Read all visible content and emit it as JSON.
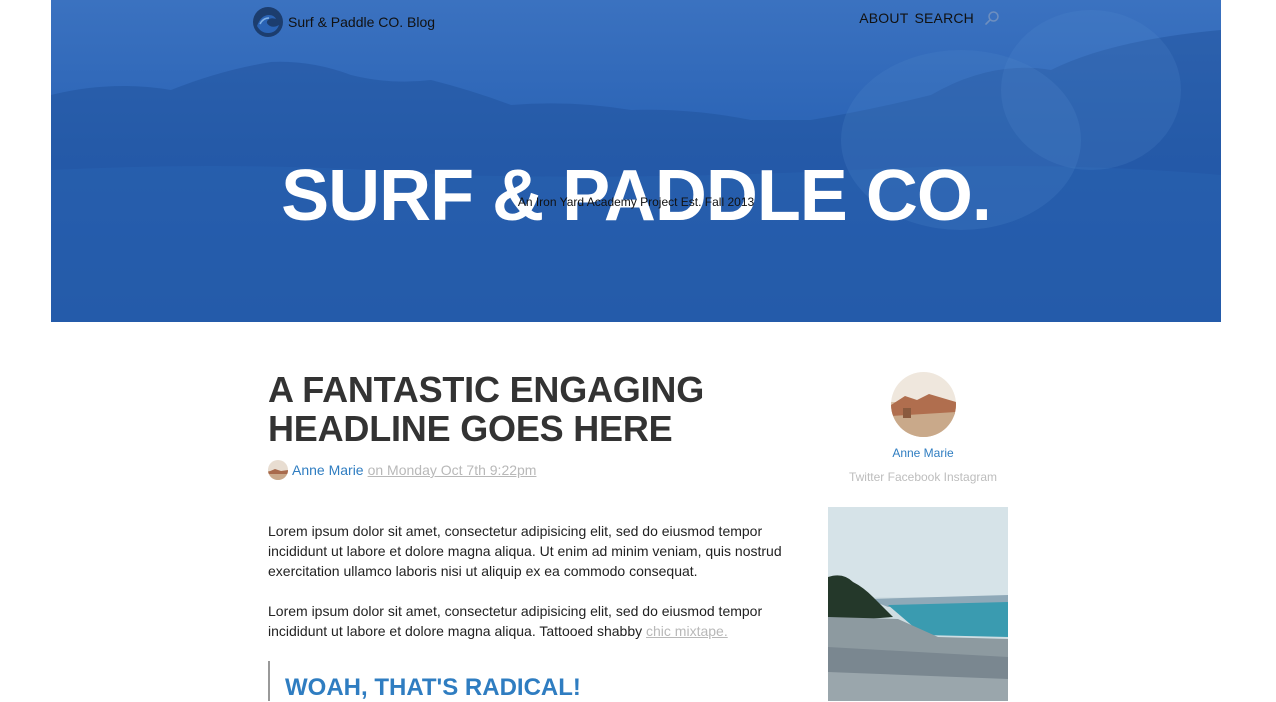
{
  "nav": {
    "brand_name": "Surf & Paddle CO. Blog",
    "links": [
      "ABOUT",
      "SEARCH"
    ],
    "search_icon": "search-icon"
  },
  "hero": {
    "title": "SURF & PADDLE CO.",
    "subtitle": "An Iron Yard Academy Project Est. Fall 2013",
    "bg_color": "#2a63b5"
  },
  "article": {
    "headline": "A FANTASTIC ENGAGING HEADLINE GOES HERE",
    "author": "Anne Marie",
    "date": "on Monday Oct 7th 9:22pm",
    "paragraph1": "Lorem ipsum dolor sit amet, consectetur adipisicing elit, sed do eiusmod tempor incididunt ut labore et dolore magna aliqua. Ut enim ad minim veniam, quis nostrud exercitation ullamco laboris nisi ut aliquip ex ea commodo consequat.",
    "paragraph2": "Lorem ipsum dolor sit amet, consectetur adipisicing elit, sed do eiusmod tempor incididunt ut labore et dolore magna aliqua. Tattooed shabby",
    "paragraph2_link": "chic mixtape.",
    "pullquote": "WOAH, THAT'S RADICAL!"
  },
  "sidebar": {
    "author_name": "Anne Marie",
    "social": "Twitter Facebook Instagram"
  },
  "colors": {
    "accent": "#2f7dc1",
    "muted": "#b8b8b8",
    "hero_blue": "#2a63b5"
  }
}
